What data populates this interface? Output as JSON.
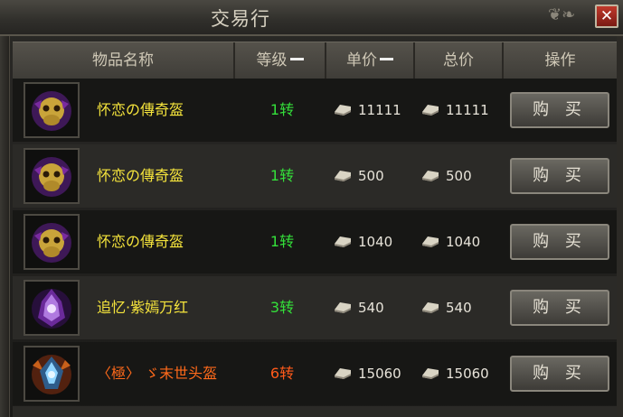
{
  "window": {
    "title": "交易行"
  },
  "columns": {
    "name": "物品名称",
    "level": "等级",
    "unit_price": "单价",
    "total_price": "总价",
    "action": "操作"
  },
  "rows": [
    {
      "name": "怀恋の傳奇盔",
      "level": "1转",
      "unit_price": "11111",
      "total_price": "11111",
      "buy": "购 买",
      "name_color": "#f5e43c",
      "level_color": "#34e03a",
      "icon": "skull-helmet-icon"
    },
    {
      "name": "怀恋の傳奇盔",
      "level": "1转",
      "unit_price": "500",
      "total_price": "500",
      "buy": "购 买",
      "name_color": "#f5e43c",
      "level_color": "#34e03a",
      "icon": "skull-helmet-icon"
    },
    {
      "name": "怀恋の傳奇盔",
      "level": "1转",
      "unit_price": "1040",
      "total_price": "1040",
      "buy": "购 买",
      "name_color": "#f5e43c",
      "level_color": "#34e03a",
      "icon": "skull-helmet-icon"
    },
    {
      "name": "追忆·紫嫣万红",
      "level": "3转",
      "unit_price": "540",
      "total_price": "540",
      "buy": "购 买",
      "name_color": "#f5e43c",
      "level_color": "#34e03a",
      "icon": "purple-helmet-icon"
    },
    {
      "name": "〈極〉 ゞ末世头盔",
      "level": "6转",
      "unit_price": "15060",
      "total_price": "15060",
      "buy": "购 买",
      "name_color": "#ff6a1a",
      "level_color": "#ff5a1a",
      "icon": "crystal-helmet-icon"
    }
  ],
  "colors": {
    "accent_yellow": "#f5e43c",
    "accent_green": "#34e03a",
    "accent_orange": "#ff6a1a"
  },
  "icons": {
    "currency": "silver-ingot-icon",
    "close": "close-icon",
    "sort": "sort-icon"
  }
}
